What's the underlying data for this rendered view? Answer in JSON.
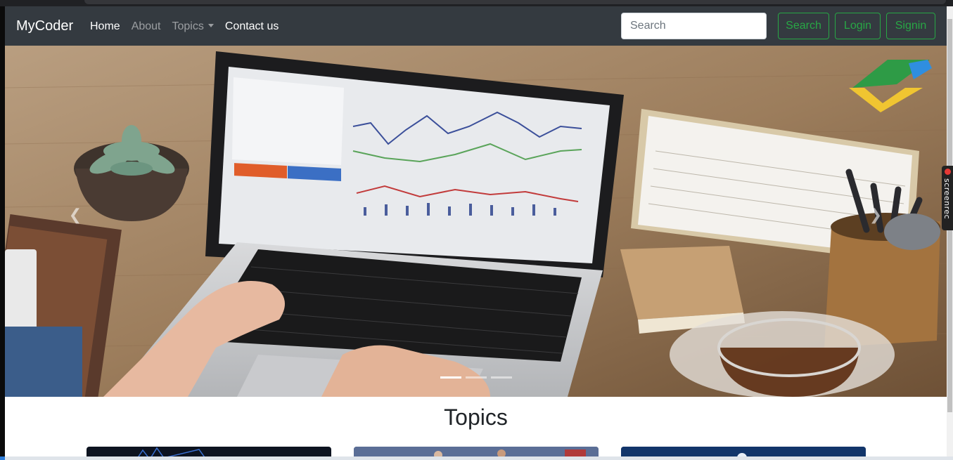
{
  "navbar": {
    "brand": "MyCoder",
    "links": [
      {
        "label": "Home"
      },
      {
        "label": "About"
      },
      {
        "label": "Topics"
      },
      {
        "label": "Contact us"
      }
    ],
    "search": {
      "placeholder": "Search"
    },
    "buttons": {
      "search": "Search",
      "login": "Login",
      "signin": "Signin"
    }
  },
  "carousel": {
    "slide_count": 3,
    "active_slide": 1,
    "prev_icon": "chevron-left-icon",
    "next_icon": "chevron-right-icon"
  },
  "topics": {
    "heading": "Topics"
  },
  "overlay": {
    "screenrec_label": "screenrec"
  },
  "colors": {
    "navbar_bg": "#343a40",
    "accent_green": "#28a745",
    "page_bg": "#ffffff"
  }
}
